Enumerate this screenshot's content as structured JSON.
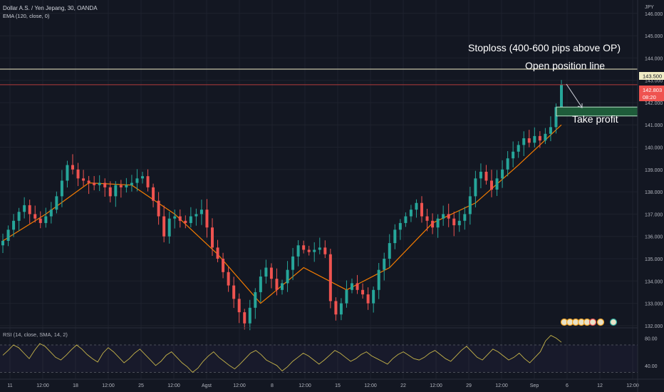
{
  "header": {
    "symbol_line": "Dollar A.S. / Yen Jepang, 30, OANDA",
    "indicator_line": "EMA (120, close, 0)"
  },
  "rsi_header": "RSI (14, close, SMA, 14, 2)",
  "currency_label": "JPY",
  "annotations": {
    "stoploss": "Stoploss (400-600 pips above OP)",
    "open_position": "Open position line",
    "take_profit": "Take profit"
  },
  "price_badges": {
    "open_position_level": "143.500",
    "current_price": "142.803",
    "countdown": "08:20"
  },
  "colors": {
    "background": "#131722",
    "up_candle": "#26a69a",
    "down_candle": "#ef5350",
    "ema": "#f57c00",
    "rsi": "#c7b54a",
    "open_position_line": "#f0ecc5",
    "current_price_line": "#b23b3b",
    "take_profit_box": "#1e5c3a"
  },
  "chart_data": [
    {
      "type": "candlestick",
      "title": "Dollar A.S. / Yen Jepang, 30, OANDA",
      "y_axis_ticks": [
        146.0,
        145.0,
        144.0,
        143.0,
        142.0,
        141.0,
        140.0,
        139.0,
        138.0,
        137.0,
        136.0,
        135.0,
        134.0,
        133.0,
        132.0
      ],
      "ylim": [
        131.9,
        146.6
      ],
      "x_axis_ticks": [
        "11",
        "12:00",
        "18",
        "12:00",
        "25",
        "12:00",
        "Agst",
        "12:00",
        "8",
        "12:00",
        "15",
        "12:00",
        "22",
        "12:00",
        "29",
        "12:00",
        "Sep",
        "6",
        "12",
        "12:00"
      ],
      "series": [
        {
          "name": "Price (approx. close)",
          "x_index": [
            0,
            1,
            2,
            3,
            4,
            5,
            6,
            7,
            8,
            9,
            10,
            11,
            12,
            13,
            14,
            15,
            16,
            17,
            18,
            19,
            20,
            21,
            22,
            23,
            24,
            25,
            26,
            27,
            28,
            29,
            30,
            31,
            32,
            33,
            34,
            35,
            36,
            37,
            38,
            39,
            40,
            41,
            42,
            43,
            44,
            45,
            46,
            47,
            48,
            49,
            50,
            51,
            52,
            53,
            54,
            55,
            56,
            57,
            58,
            59,
            60,
            61,
            62,
            63,
            64,
            65,
            66,
            67,
            68,
            69,
            70,
            71,
            72,
            73,
            74,
            75,
            76,
            77,
            78,
            79,
            80,
            81,
            82,
            83,
            84,
            85,
            86,
            87,
            88,
            89,
            90,
            91,
            92,
            93,
            94,
            95,
            96,
            97,
            98,
            99,
            100,
            101,
            102,
            103,
            104,
            105,
            106,
            107,
            108,
            109,
            110,
            111,
            112,
            113,
            114,
            115,
            116,
            117,
            118,
            119,
            120,
            121,
            122,
            123,
            124,
            125,
            126,
            127,
            128,
            129,
            130,
            131,
            132,
            133,
            134,
            135,
            136,
            137,
            138,
            139,
            140,
            141,
            142,
            143,
            144,
            145,
            146,
            147,
            148,
            149,
            150,
            151,
            152,
            153,
            154,
            155,
            156,
            157
          ],
          "values": [
            135.8,
            136.3,
            136.7,
            137.1,
            137.4,
            137.0,
            136.8,
            136.6,
            136.9,
            137.2,
            137.8,
            138.5,
            139.2,
            139.0,
            138.6,
            138.5,
            138.4,
            138.3,
            138.4,
            138.2,
            137.8,
            138.3,
            138.2,
            138.3,
            138.4,
            138.6,
            138.7,
            138.2,
            137.6,
            136.9,
            136.0,
            136.8,
            136.9,
            136.7,
            136.6,
            136.9,
            137.0,
            137.2,
            136.4,
            135.5,
            135.0,
            134.4,
            133.8,
            133.2,
            132.6,
            132.1,
            132.8,
            133.5,
            134.2,
            134.6,
            134.1,
            133.6,
            133.9,
            134.5,
            135.1,
            135.6,
            135.4,
            135.3,
            135.4,
            135.5,
            135.2,
            133.1,
            132.5,
            133.0,
            133.6,
            133.9,
            133.6,
            133.4,
            133.0,
            133.6,
            134.5,
            135.0,
            135.7,
            136.3,
            136.6,
            136.9,
            137.2,
            137.5,
            136.9,
            136.7,
            136.4,
            136.8,
            137.0,
            136.8,
            136.5,
            136.7,
            137.0,
            137.8,
            138.6,
            138.9,
            138.5,
            138.1,
            138.6,
            139.0,
            139.5,
            139.8,
            140.1,
            140.4,
            140.2,
            140.5,
            140.3,
            140.6,
            140.9,
            141.8,
            142.8
          ],
          "color_up": "#26a69a",
          "color_down": "#ef5350"
        },
        {
          "name": "EMA (120, close, 0)",
          "x_index": [
            0,
            8,
            16,
            24,
            32,
            40,
            48,
            56,
            64,
            72,
            80,
            88,
            96,
            104
          ],
          "values": [
            135.8,
            137.0,
            138.4,
            138.3,
            137.0,
            135.2,
            133.0,
            134.6,
            133.6,
            134.6,
            136.6,
            137.5,
            139.2,
            141.0
          ],
          "color": "#f57c00"
        }
      ],
      "horizontal_lines": [
        {
          "name": "Open position line",
          "value": 143.5,
          "color": "#f0ecc5"
        },
        {
          "name": "Current price",
          "value": 142.803,
          "color": "#b23b3b"
        }
      ],
      "take_profit_zone": [
        141.4,
        141.8
      ],
      "grid": true,
      "legend": "top-left"
    },
    {
      "type": "line",
      "title": "RSI (14, close, SMA, 14, 2)",
      "y_axis_ticks": [
        80.0,
        40.0
      ],
      "ylim": [
        20,
        95
      ],
      "bands": [
        70,
        30
      ],
      "series": [
        {
          "name": "RSI",
          "values": [
            55,
            62,
            70,
            66,
            58,
            50,
            62,
            72,
            68,
            60,
            52,
            48,
            55,
            63,
            70,
            64,
            56,
            50,
            45,
            58,
            66,
            60,
            52,
            44,
            50,
            58,
            64,
            56,
            48,
            40,
            46,
            55,
            60,
            52,
            44,
            38,
            30,
            36,
            46,
            54,
            60,
            52,
            46,
            40,
            35,
            42,
            50,
            58,
            62,
            56,
            48,
            44,
            40,
            32,
            38,
            46,
            52,
            58,
            54,
            48,
            42,
            48,
            55,
            62,
            58,
            52,
            46,
            50,
            56,
            60,
            54,
            50,
            46,
            42,
            50,
            56,
            60,
            55,
            50,
            48,
            52,
            58,
            62,
            56,
            50,
            46,
            54,
            62,
            68,
            60,
            52,
            48,
            56,
            64,
            60,
            54,
            48,
            52,
            58,
            50,
            44,
            52,
            60,
            76,
            84,
            80,
            74
          ],
          "color": "#c7b54a"
        }
      ]
    }
  ]
}
